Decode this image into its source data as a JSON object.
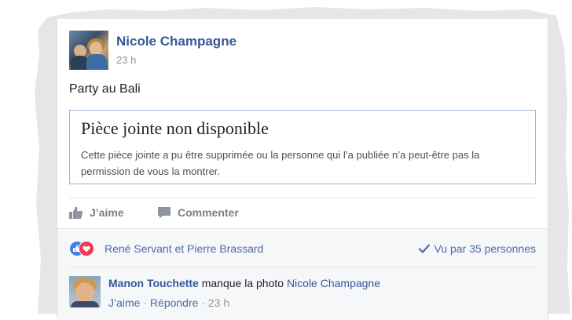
{
  "post": {
    "author": "Nicole Champagne",
    "time": "23 h",
    "text": "Party au Bali"
  },
  "attachment": {
    "title": "Pièce jointe non disponible",
    "body": "Cette pièce jointe a pu être supprimée ou la personne qui l’a publiée n’a peut-être pas la permission de vous la montrer."
  },
  "actions": {
    "like": "J’aime",
    "comment": "Commenter"
  },
  "reactions": {
    "icons": [
      "thumbs-up-icon",
      "heart-icon"
    ],
    "likers": "René Servant et Pierre Brassard",
    "seen": "Vu par 35 personnes"
  },
  "comment": {
    "author": "Manon Touchette",
    "text": "manque la photo",
    "mention": "Nicole Champagne",
    "like": "J’aime",
    "separator": " · ",
    "reply": "Répondre",
    "time": "23 h"
  },
  "colors": {
    "link": "#365899",
    "like_reaction": "#4a7fe0",
    "love_reaction": "#f0394f",
    "footer_bg": "#f6f7f9"
  }
}
